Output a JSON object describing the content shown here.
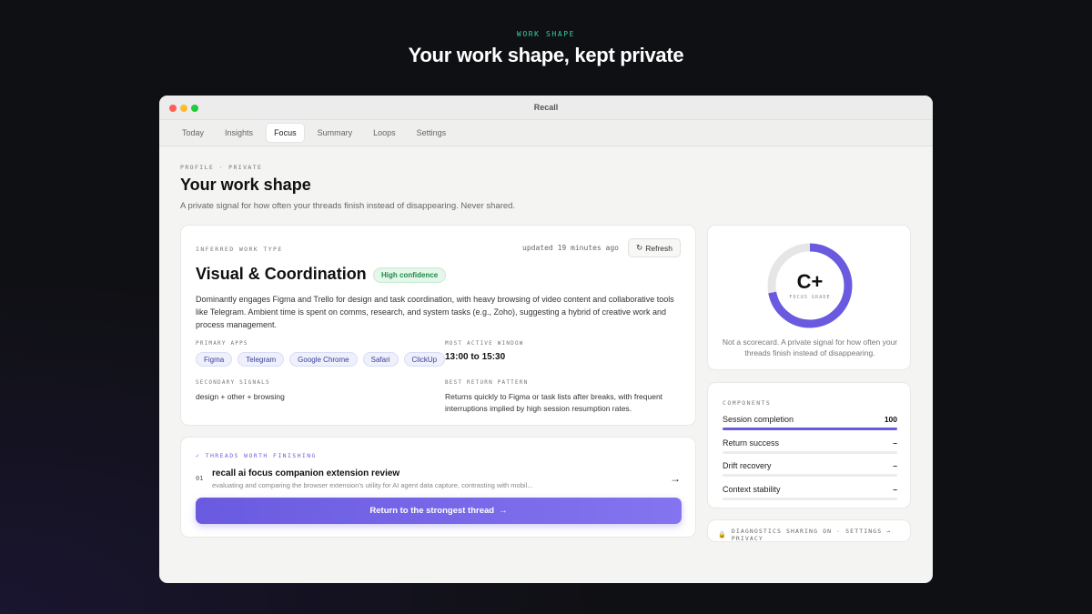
{
  "hero": {
    "eyebrow": "WORK SHAPE",
    "title": "Your work shape, kept private"
  },
  "window": {
    "title": "Recall"
  },
  "tabs": [
    {
      "label": "Today"
    },
    {
      "label": "Insights"
    },
    {
      "label": "Focus",
      "active": true
    },
    {
      "label": "Summary"
    },
    {
      "label": "Loops"
    },
    {
      "label": "Settings"
    }
  ],
  "profile": {
    "eyebrow": "PROFILE · PRIVATE",
    "title": "Your work shape",
    "subtitle": "A private signal for how often your threads finish instead of disappearing. Never shared."
  },
  "inferred": {
    "eyebrow": "INFERRED WORK TYPE",
    "updated": "updated 19 minutes ago",
    "refresh_label": "Refresh",
    "work_type": "Visual & Coordination",
    "confidence": "High confidence",
    "description": "Dominantly engages Figma and Trello for design and task coordination, with heavy browsing of video content and collaborative tools like Telegram. Ambient time is spent on comms, research, and system tasks (e.g., Zoho), suggesting a hybrid of creative work and process management.",
    "primary_apps_label": "PRIMARY APPS",
    "primary_apps": [
      "Figma",
      "Telegram",
      "Google Chrome",
      "Safari",
      "ClickUp"
    ],
    "most_active_label": "MOST ACTIVE WINDOW",
    "most_active": "13:00 to 15:30",
    "secondary_label": "SECONDARY SIGNALS",
    "secondary": "design + other + browsing",
    "return_label": "BEST RETURN PATTERN",
    "return_pattern": "Returns quickly to Figma or task lists after breaks, with frequent interruptions implied by high session resumption rates."
  },
  "threads": {
    "eyebrow": "✓ THREADS WORTH FINISHING",
    "items": [
      {
        "num": "01",
        "title": "recall ai focus companion extension review",
        "subtitle": "evaluating and comparing the browser extension's utility for AI agent data capture, contrasting with mobil..."
      }
    ],
    "cta": "Return to the strongest thread",
    "cta_arrow": "→",
    "row_arrow": "→"
  },
  "grade": {
    "value": "C+",
    "label": "FOCUS GRADE",
    "progress": 0.72,
    "note": "Not a scorecard. A private signal for how often your threads finish instead of disappearing.",
    "accent": "#6a5ae0",
    "track": "#e6e6e6"
  },
  "components": {
    "eyebrow": "COMPONENTS",
    "items": [
      {
        "name": "Session completion",
        "value": "100",
        "fill": 1.0
      },
      {
        "name": "Return success",
        "value": "–",
        "fill": 0
      },
      {
        "name": "Drift recovery",
        "value": "–",
        "fill": 0
      },
      {
        "name": "Context stability",
        "value": "–",
        "fill": 0
      }
    ]
  },
  "diagnostics": {
    "icon": "lock-icon",
    "text": "DIAGNOSTICS SHARING ON · SETTINGS → PRIVACY"
  }
}
